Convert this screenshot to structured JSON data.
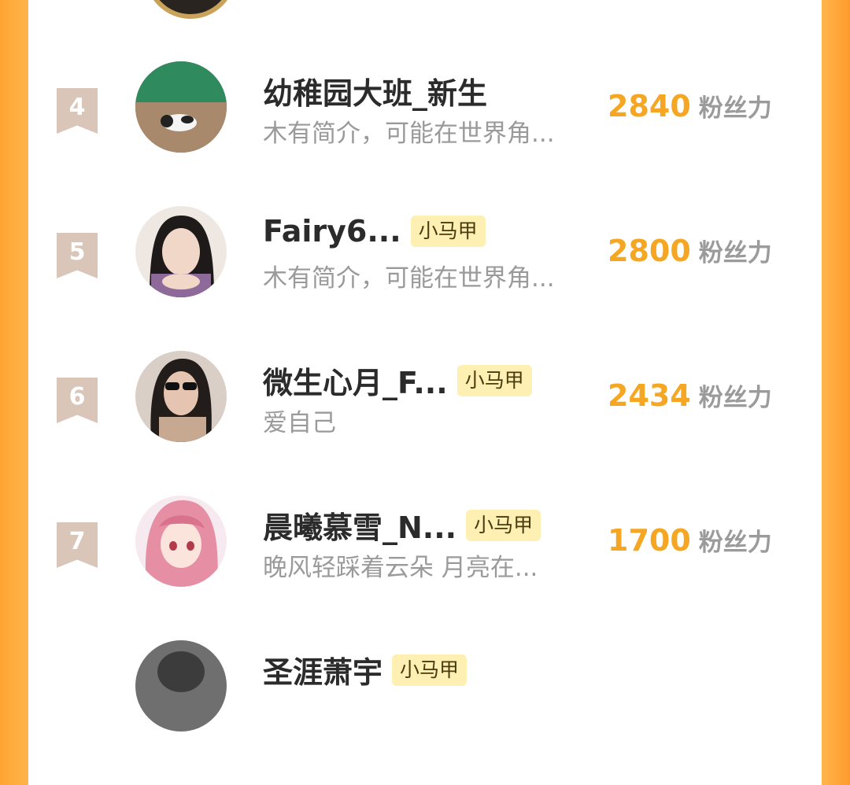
{
  "rows": [
    {
      "rank": "4",
      "name": "幼稚园大班_新生",
      "badge": "",
      "bio": "木有简介，可能在世界角...",
      "score": "2840",
      "unit": "粉丝力"
    },
    {
      "rank": "5",
      "name": "Fairy6...",
      "badge": "小马甲",
      "bio": "木有简介，可能在世界角...",
      "score": "2800",
      "unit": "粉丝力"
    },
    {
      "rank": "6",
      "name": "微生心月_F...",
      "badge": "小马甲",
      "bio": "爱自己",
      "score": "2434",
      "unit": "粉丝力"
    },
    {
      "rank": "7",
      "name": "晨曦慕雪_N...",
      "badge": "小马甲",
      "bio": "晚风轻踩着云朵 月亮在...",
      "score": "1700",
      "unit": "粉丝力"
    },
    {
      "name": "圣涯萧宇",
      "badge": "小马甲"
    }
  ],
  "colors": {
    "accent": "#f5a623",
    "border": "#ffa433",
    "rank_badge": "#d9c6b9",
    "tag_bg": "#fdf0b2"
  }
}
